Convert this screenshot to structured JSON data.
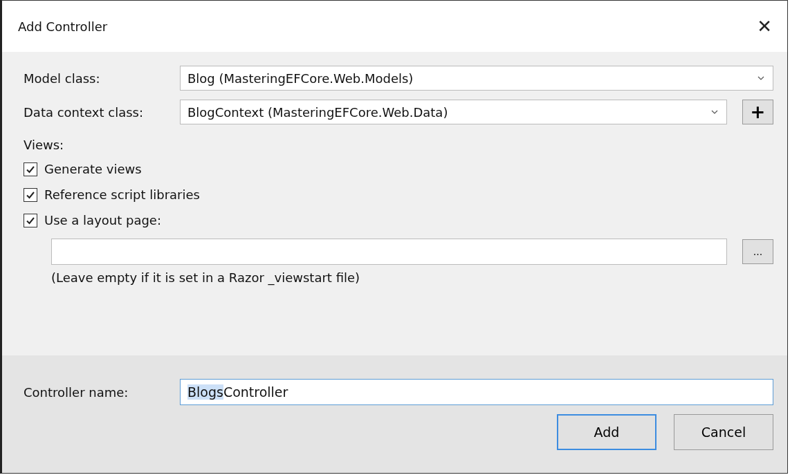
{
  "window": {
    "title": "Add Controller",
    "close": "✕"
  },
  "fields": [
    {
      "label": "Model class:",
      "value": "Blog (MasteringEFCore.Web.Models)"
    },
    {
      "label": "Data context class:",
      "value": "BlogContext (MasteringEFCore.Web.Data)",
      "add_button": "+"
    }
  ],
  "views": {
    "label": "Views:",
    "options": [
      {
        "label": "Generate views",
        "checked": true
      },
      {
        "label": "Reference script libraries",
        "checked": true
      },
      {
        "label": "Use a layout page:",
        "checked": true
      }
    ],
    "layout_field": {
      "browse": "..."
    },
    "hint": "(Leave empty if it is set in a Razor _viewstart file)"
  },
  "controller_name": {
    "label": "Controller name:",
    "value": [
      {
        "text": "Blogs",
        "selected": true
      },
      {
        "text": "Controller",
        "selected": false
      }
    ]
  },
  "buttons": [
    {
      "label": "Add",
      "kind": "default"
    },
    {
      "label": "Cancel",
      "kind": "normal"
    }
  ]
}
